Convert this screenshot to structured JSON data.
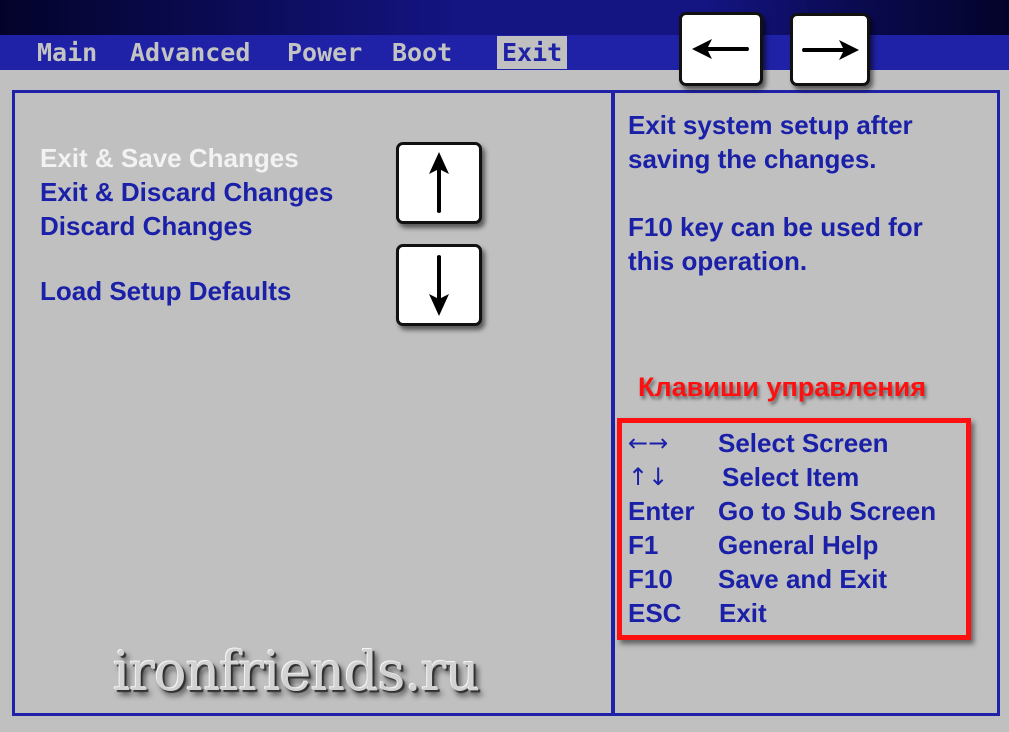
{
  "menu": {
    "tabs": [
      {
        "label": "Main"
      },
      {
        "label": "Advanced"
      },
      {
        "label": "Power"
      },
      {
        "label": "Boot"
      },
      {
        "label": "Exit",
        "active": true
      }
    ]
  },
  "nav_keys": {
    "left": "left-arrow-key-icon",
    "right": "right-arrow-key-icon",
    "up": "up-arrow-key-icon",
    "down": "down-arrow-key-icon"
  },
  "options": [
    {
      "label": "Exit & Save Changes",
      "selected": true
    },
    {
      "label": "Exit & Discard Changes"
    },
    {
      "label": "Discard Changes"
    },
    {
      "label": "Load Setup Defaults"
    }
  ],
  "help": {
    "line1": "Exit system setup after",
    "line2": "saving the changes.",
    "line3": "F10 key can be used for",
    "line4": "this operation."
  },
  "keys_title": "Клавиши управления",
  "keys": [
    {
      "key": "←→",
      "desc": "Select Screen"
    },
    {
      "key": "↑↓",
      "desc": "Select Item"
    },
    {
      "key": "Enter",
      "desc": "Go to Sub Screen"
    },
    {
      "key": "F1",
      "desc": "General Help"
    },
    {
      "key": "F10",
      "desc": "Save and Exit"
    },
    {
      "key": "ESC",
      "desc": "Exit"
    }
  ],
  "watermark": "ironfriends.ru",
  "colors": {
    "menu_bar": "#1f22a6",
    "text_blue": "#1a20a8",
    "highlight_white": "#f2f2f2",
    "annotation_red": "#ff1010",
    "background_gray": "#c0c0c0"
  }
}
